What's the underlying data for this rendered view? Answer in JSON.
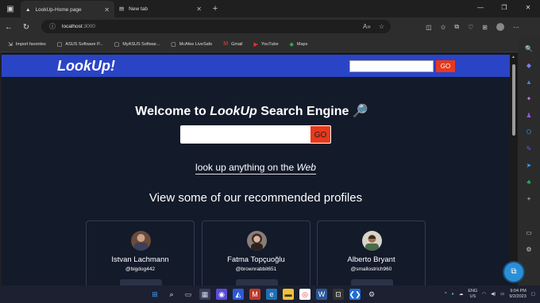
{
  "browser": {
    "tabs": [
      {
        "title": "LookUp-Home page",
        "active": true
      },
      {
        "title": "New tab",
        "active": false
      }
    ],
    "address": {
      "host": "localhost",
      "port": ":3000"
    },
    "favorites": [
      {
        "label": "Import favorites",
        "icon": "import-icon"
      },
      {
        "label": "ASUS Software P...",
        "icon": "page-icon"
      },
      {
        "label": "MyASUS Softwar...",
        "icon": "page-icon"
      },
      {
        "label": "McAfee LiveSafe",
        "icon": "page-icon"
      },
      {
        "label": "Gmail",
        "icon": "gmail-icon"
      },
      {
        "label": "YouTube",
        "icon": "youtube-icon"
      },
      {
        "label": "Maps",
        "icon": "maps-icon"
      }
    ]
  },
  "site": {
    "logo": "LookUp!",
    "header_go": "GO",
    "welcome_prefix": "Welcome to ",
    "welcome_brand": "LookUp",
    "welcome_suffix": " Search Engine",
    "main_go": "GO",
    "tagline_prefix": "look up anything on the ",
    "tagline_emph": "Web",
    "recommend_heading": "View some of our recommended profiles",
    "profiles": [
      {
        "name": "Istvan Lachmann",
        "handle": "@bigdog442"
      },
      {
        "name": "Fatma Topçuoğlu",
        "handle": "@brownrabbit651"
      },
      {
        "name": "Alberto Bryant",
        "handle": "@smallostrich960"
      }
    ]
  },
  "taskbar": {
    "lang": "ENG",
    "region": "US",
    "time": "9:04 PM",
    "date": "9/2/2023"
  },
  "colors": {
    "header": "#2a44c6",
    "go_button": "#e8391c",
    "page_bg": "#131a2a"
  }
}
